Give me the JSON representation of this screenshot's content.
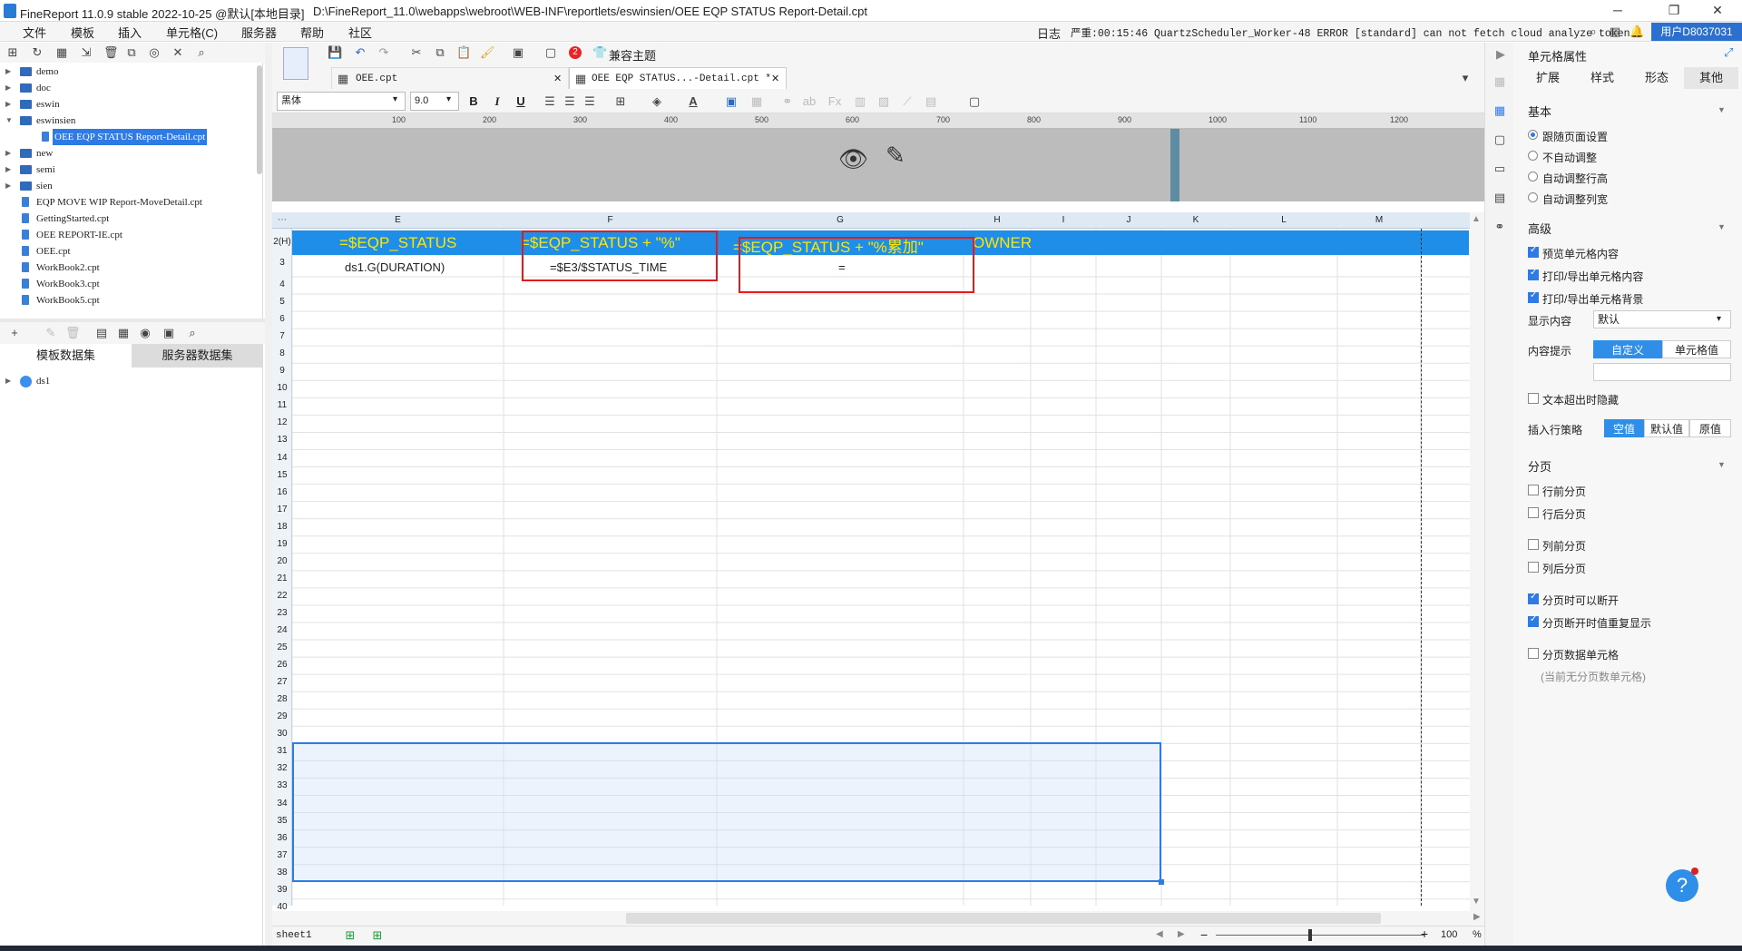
{
  "window": {
    "title": "FineReport 11.0.9 stable 2022-10-25 @默认[本地目录]",
    "path": "D:\\FineReport_11.0\\webapps\\webroot\\WEB-INF\\reportlets/eswinsien/OEE EQP STATUS Report-Detail.cpt",
    "minimize": "─",
    "maximize": "❐",
    "close": "✕"
  },
  "menu": [
    "文件",
    "模板",
    "插入",
    "单元格(C)",
    "服务器",
    "帮助",
    "社区"
  ],
  "log": {
    "label": "日志",
    "message": "严重:00:15:46 QuartzScheduler_Worker-48 ERROR [standard] can not fetch cloud analyze token."
  },
  "user": "用户D8037031",
  "tree": [
    {
      "label": "demo",
      "type": "folder",
      "expanded": false
    },
    {
      "label": "doc",
      "type": "folder",
      "expanded": false
    },
    {
      "label": "eswin",
      "type": "folder",
      "expanded": false
    },
    {
      "label": "eswinsien",
      "type": "folder",
      "expanded": true
    },
    {
      "label": "OEE EQP STATUS Report-Detail.cpt",
      "type": "file",
      "selected": true
    },
    {
      "label": "new",
      "type": "folder",
      "expanded": false
    },
    {
      "label": "semi",
      "type": "folder",
      "expanded": false
    },
    {
      "label": "sien",
      "type": "folder",
      "expanded": false
    },
    {
      "label": "EQP MOVE WIP Report-MoveDetail.cpt",
      "type": "file"
    },
    {
      "label": "GettingStarted.cpt",
      "type": "file"
    },
    {
      "label": "OEE REPORT-IE.cpt",
      "type": "file"
    },
    {
      "label": "OEE.cpt",
      "type": "file"
    },
    {
      "label": "WorkBook2.cpt",
      "type": "file"
    },
    {
      "label": "WorkBook3.cpt",
      "type": "file"
    },
    {
      "label": "WorkBook5.cpt",
      "type": "file"
    }
  ],
  "dataset_tabs": [
    "模板数据集",
    "服务器数据集"
  ],
  "datasets": [
    "ds1"
  ],
  "ribbon": {
    "badge": "2",
    "theme_label": "兼容主题"
  },
  "doc_tabs": [
    "OEE.cpt",
    "OEE EQP STATUS...-Detail.cpt *"
  ],
  "format": {
    "font": "黑体",
    "size": "9.0",
    "bold": "B",
    "italic": "I",
    "underline": "U"
  },
  "ruler": [
    "100",
    "200",
    "300",
    "400",
    "500",
    "600",
    "700",
    "800",
    "900",
    "1000",
    "1100",
    "1200"
  ],
  "columns": [
    "E",
    "F",
    "G",
    "H",
    "I",
    "J",
    "K",
    "L",
    "M"
  ],
  "rows": [
    "2(H)",
    "3",
    "4",
    "5",
    "6",
    "7",
    "8",
    "9",
    "10",
    "11",
    "12",
    "13",
    "14",
    "15",
    "16",
    "17",
    "18",
    "19",
    "20",
    "21",
    "22",
    "23",
    "24",
    "25",
    "26",
    "27",
    "28",
    "29",
    "30",
    "31",
    "32",
    "33",
    "34",
    "35",
    "36",
    "37",
    "38",
    "39",
    "40"
  ],
  "cells": {
    "E2": "=$EQP_STATUS",
    "F2": "=$EQP_STATUS + \"%\"",
    "G2": "=$EQP_STATUS + \"%累加\"",
    "H2": "OWNER",
    "E3": "ds1.G(DURATION)",
    "F3": "=$E3/$STATUS_TIME",
    "G3": "="
  },
  "sheet": {
    "name": "sheet1",
    "zoom": "100",
    "percent": "%"
  },
  "props": {
    "title": "单元格属性",
    "tabs": [
      "扩展",
      "样式",
      "形态",
      "其他"
    ],
    "basic": {
      "title": "基本",
      "options": [
        {
          "label": "跟随页面设置",
          "checked": true
        },
        {
          "label": "不自动调整",
          "checked": false
        },
        {
          "label": "自动调整行高",
          "checked": false
        },
        {
          "label": "自动调整列宽",
          "checked": false
        }
      ]
    },
    "advanced": {
      "title": "高级",
      "checks": [
        {
          "label": "预览单元格内容",
          "checked": true
        },
        {
          "label": "打印/导出单元格内容",
          "checked": true
        },
        {
          "label": "打印/导出单元格背景",
          "checked": true
        }
      ],
      "display_label": "显示内容",
      "display_value": "默认",
      "tooltip_label": "内容提示",
      "tooltip_options": [
        "自定义",
        "单元格值"
      ],
      "overflow_label": "文本超出时隐藏",
      "insert_label": "插入行策略",
      "insert_options": [
        "空值",
        "默认值",
        "原值"
      ]
    },
    "paging": {
      "title": "分页",
      "checks": [
        {
          "label": "行前分页",
          "checked": false
        },
        {
          "label": "行后分页",
          "checked": false
        },
        {
          "label": "列前分页",
          "checked": false
        },
        {
          "label": "列后分页",
          "checked": false
        },
        {
          "label": "分页时可以断开",
          "checked": true
        },
        {
          "label": "分页断开时值重复显示",
          "checked": true
        },
        {
          "label": "分页数据单元格",
          "checked": false
        }
      ],
      "note": "(当前无分页数单元格)"
    }
  },
  "help": "?"
}
